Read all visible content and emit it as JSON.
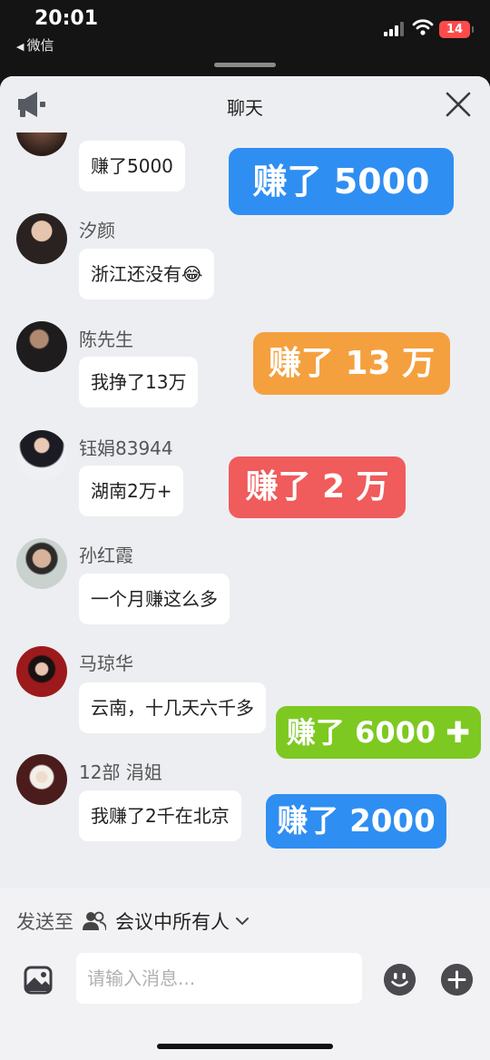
{
  "status_bar": {
    "time": "20:01",
    "back_app": "微信",
    "battery": "14"
  },
  "header": {
    "title": "聊天"
  },
  "messages": [
    {
      "sender": "",
      "text": "赚了5000"
    },
    {
      "sender": "汐颜",
      "text": "浙江还没有😂"
    },
    {
      "sender": "陈先生",
      "text": "我挣了13万"
    },
    {
      "sender": "钰娟83944",
      "text": "湖南2万+"
    },
    {
      "sender": "孙红霞",
      "text": "一个月赚这么多"
    },
    {
      "sender": "马琼华",
      "text": "云南，十几天六千多"
    },
    {
      "sender": "12部 涓姐",
      "text": "我赚了2千在北京"
    }
  ],
  "stickers": [
    {
      "text": "赚了 5000",
      "color": "#2f8ef2"
    },
    {
      "text": "赚了 13 万",
      "color": "#f5a03f"
    },
    {
      "text": "赚了 2 万",
      "color": "#f05b5b"
    },
    {
      "text": "赚了 6000 ✚",
      "color": "#7dc921"
    },
    {
      "text": "赚了 2000",
      "color": "#2f8ef2"
    }
  ],
  "composer": {
    "send_to_label": "发送至",
    "audience": "会议中所有人",
    "placeholder": "请输入消息..."
  }
}
